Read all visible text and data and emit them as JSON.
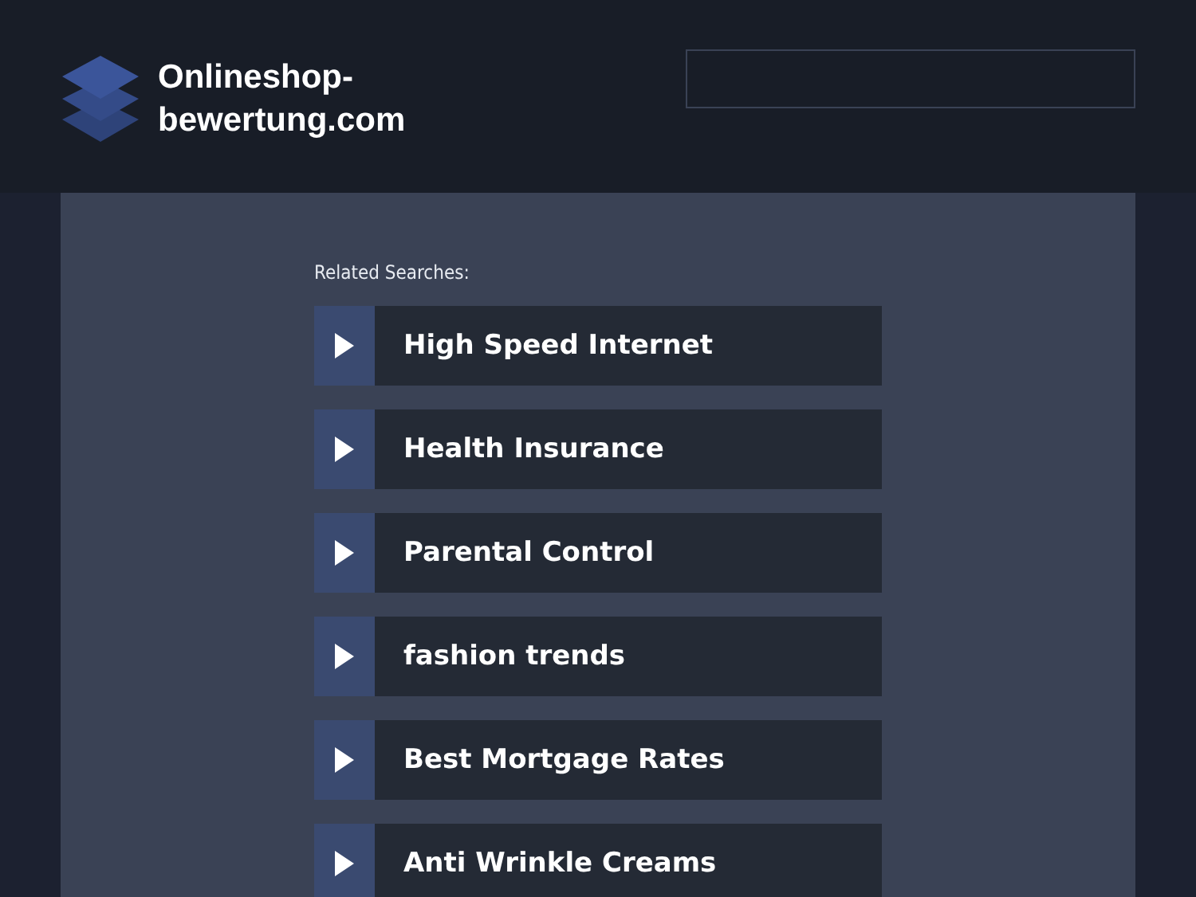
{
  "header": {
    "logo_text": "Onlineshop-bewertung.com"
  },
  "related": {
    "title": "Related Searches:",
    "links": [
      {
        "label": "High Speed Internet"
      },
      {
        "label": "Health Insurance"
      },
      {
        "label": "Parental Control"
      },
      {
        "label": "fashion trends"
      },
      {
        "label": "Best Mortgage Rates"
      },
      {
        "label": "Anti Wrinkle Creams"
      }
    ]
  }
}
